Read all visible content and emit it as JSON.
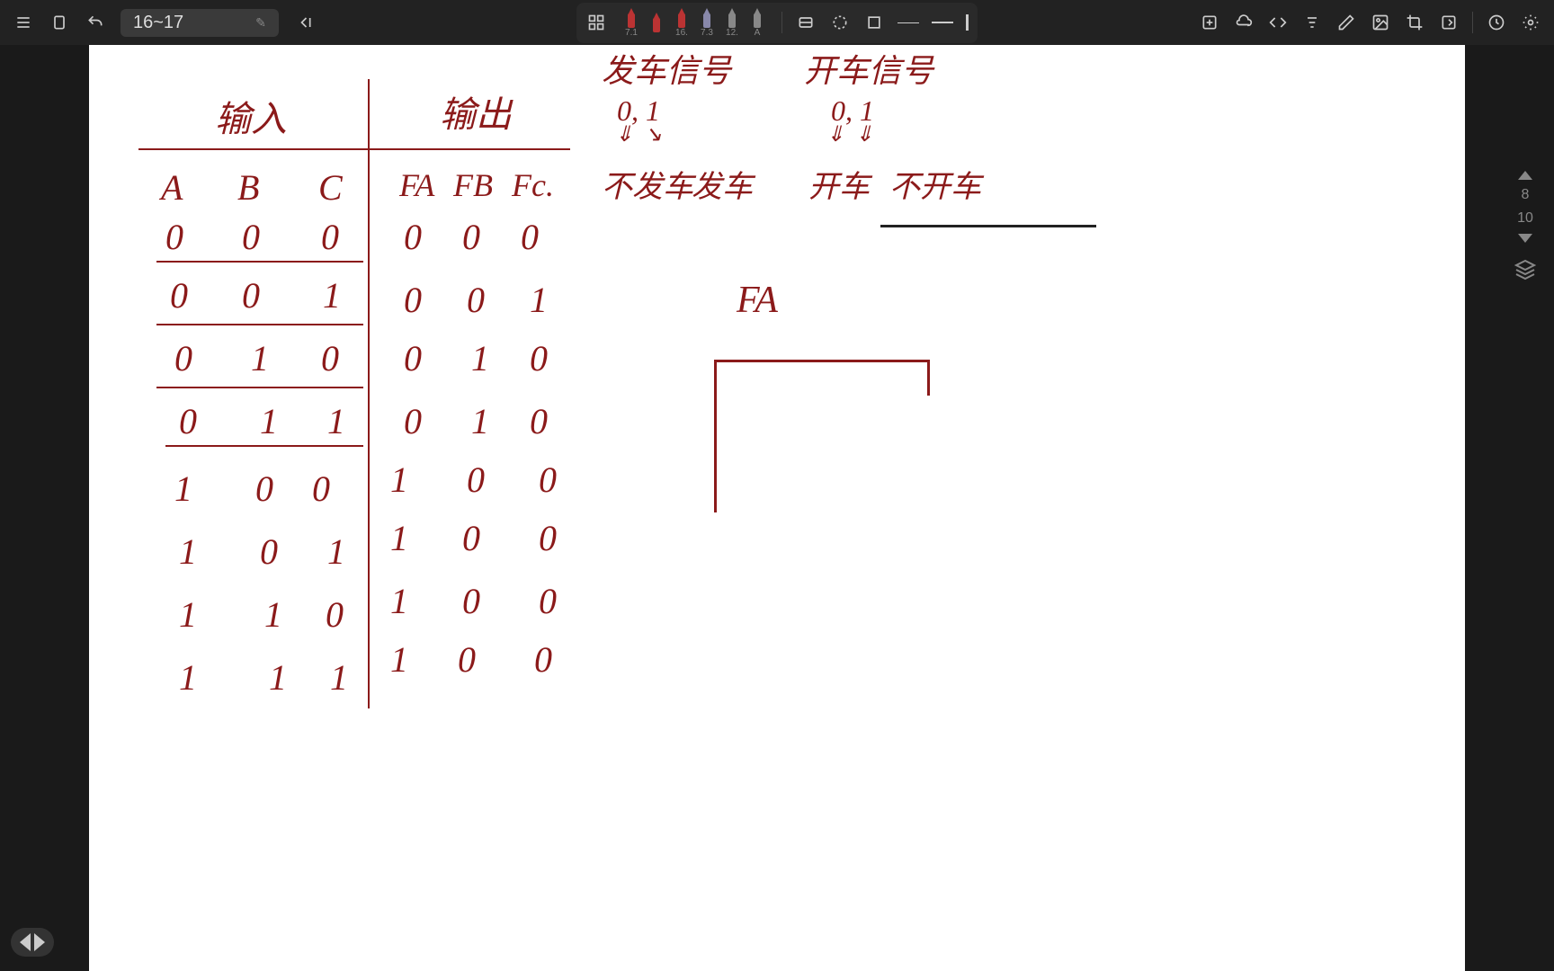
{
  "toolbar": {
    "page_range": "16~17",
    "pens": [
      {
        "label": "7.1",
        "color": "red"
      },
      {
        "label": "",
        "color": "red"
      },
      {
        "label": "16.",
        "color": "red"
      },
      {
        "label": "7.3",
        "color": "purple"
      },
      {
        "label": "12.",
        "color": "gray"
      },
      {
        "label": "A",
        "color": "gray"
      }
    ]
  },
  "side": {
    "page_current": "8",
    "page_total": "10"
  },
  "handwriting": {
    "header_input": "输入",
    "header_output": "输出",
    "col_A": "A",
    "col_B": "B",
    "col_C": "C",
    "col_FA": "FA",
    "col_FB": "FB",
    "col_FC": "Fc.",
    "note1_title": "发车信号",
    "note1_vals": "0, 1",
    "note1_a": "不发车",
    "note1_b": "发车",
    "note2_title": "开车信号",
    "note2_vals": "0, 1",
    "note2_a": "开车",
    "note2_b": "不开车",
    "fa_label": "FA",
    "rows": [
      {
        "A": "0",
        "B": "0",
        "C": "0",
        "FA": "0",
        "FB": "0",
        "FC": "0"
      },
      {
        "A": "0",
        "B": "0",
        "C": "1",
        "FA": "0",
        "FB": "0",
        "FC": "1"
      },
      {
        "A": "0",
        "B": "1",
        "C": "0",
        "FA": "0",
        "FB": "1",
        "FC": "0"
      },
      {
        "A": "0",
        "B": "1",
        "C": "1",
        "FA": "0",
        "FB": "1",
        "FC": "0"
      },
      {
        "A": "1",
        "B": "0",
        "C": "0",
        "FA": "1",
        "FB": "0",
        "FC": "0"
      },
      {
        "A": "1",
        "B": "0",
        "C": "1",
        "FA": "1",
        "FB": "0",
        "FC": "0"
      },
      {
        "A": "1",
        "B": "1",
        "C": "0",
        "FA": "1",
        "FB": "0",
        "FC": "0"
      },
      {
        "A": "1",
        "B": "1",
        "C": "1",
        "FA": "1",
        "FB": "0",
        "FC": "0"
      }
    ]
  }
}
